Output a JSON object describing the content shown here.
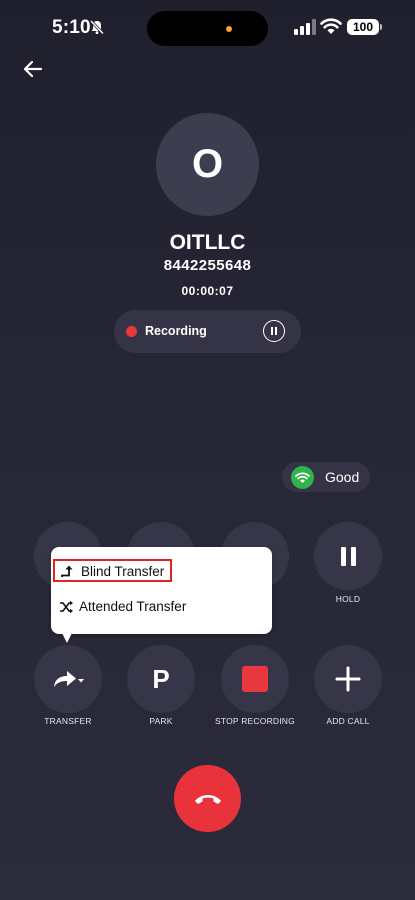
{
  "status_bar": {
    "time": "5:10",
    "battery": "100"
  },
  "contact": {
    "initial": "O",
    "name": "OITLLC",
    "number": "8442255648",
    "duration": "00:00:07"
  },
  "recording": {
    "label": "Recording",
    "dot_color": "#e8383d"
  },
  "call_quality": {
    "label": "Good",
    "color": "#2fb34a"
  },
  "controls": {
    "hold": "HOLD",
    "transfer": "TRANSFER",
    "park": "PARK",
    "park_glyph": "P",
    "stop_recording": "STOP RECORDING",
    "add_call": "ADD CALL"
  },
  "transfer_menu": {
    "blind": "Blind Transfer",
    "attended": "Attended Transfer"
  },
  "colors": {
    "end_call": "#e8333a",
    "highlight_border": "#e02424"
  }
}
